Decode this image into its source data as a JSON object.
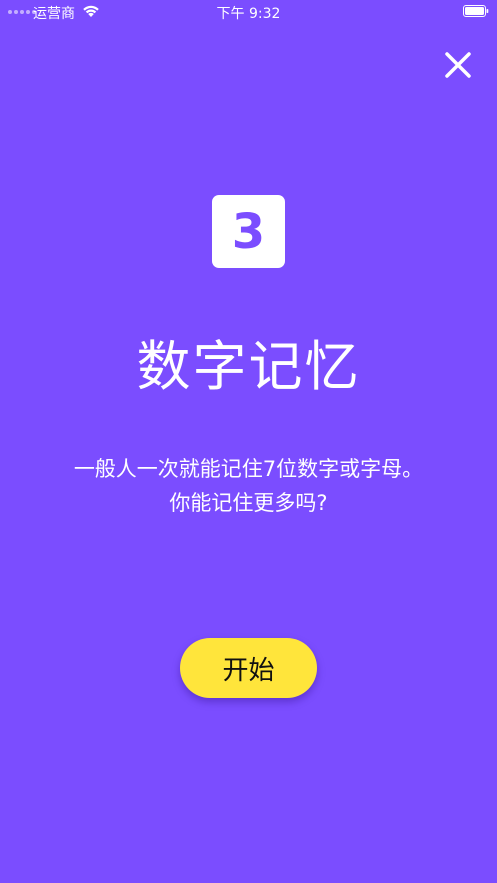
{
  "status_bar": {
    "carrier": "运营商",
    "time": "下午 9:32",
    "wifi_icon": "wifi-icon",
    "battery_icon": "battery-icon"
  },
  "header": {
    "close_icon": "close-icon"
  },
  "game": {
    "number_badge": "3",
    "title": "数字记忆",
    "description_line1": "一般人一次就能记住7位数字或字母。",
    "description_line2": "你能记住更多吗?",
    "start_label": "开始"
  },
  "colors": {
    "background": "#7b4dff",
    "button": "#ffe53b",
    "badge": "#ffffff",
    "text": "#ffffff"
  }
}
